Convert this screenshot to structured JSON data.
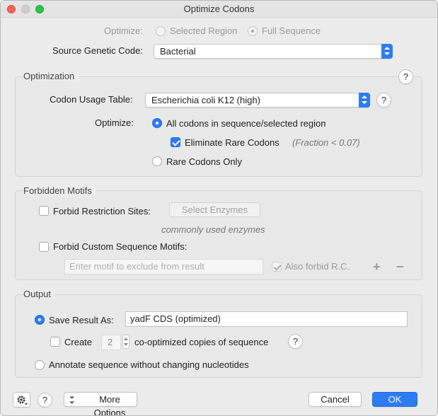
{
  "window": {
    "title": "Optimize Codons"
  },
  "top": {
    "optimize_label": "Optimize:",
    "selected_region": "Selected Region",
    "full_sequence": "Full Sequence",
    "source_code_label": "Source Genetic Code:",
    "source_code_value": "Bacterial"
  },
  "optimization": {
    "title": "Optimization",
    "help": "?",
    "usage_table_label": "Codon Usage Table:",
    "usage_table_value": "Escherichia coli K12 (high)",
    "usage_help": "?",
    "optimize_label": "Optimize:",
    "all_codons": "All codons in sequence/selected region",
    "eliminate_rare": "Eliminate Rare Codons",
    "fraction": "(Fraction < 0.07)",
    "rare_only": "Rare Codons Only"
  },
  "forbidden": {
    "title": "Forbidden Motifs",
    "restriction_sites": "Forbid Restriction Sites:",
    "select_enzymes": "Select Enzymes",
    "enzymes_note": "commonly used enzymes",
    "custom_motifs": "Forbid Custom Sequence Motifs:",
    "motif_placeholder": "Enter motif to exclude from result",
    "also_forbid": "Also forbid R.C.",
    "plus": "+",
    "minus": "−"
  },
  "output": {
    "title": "Output",
    "save_result_as": "Save Result As:",
    "result_name": "yadF CDS (optimized)",
    "create": "Create",
    "copies_count": "2",
    "copies_label": "co-optimized copies of sequence",
    "copies_help": "?",
    "annotate": "Annotate sequence without changing nucleotides"
  },
  "footer": {
    "help": "?",
    "more_options": "More Options",
    "cancel": "Cancel",
    "ok": "OK"
  }
}
